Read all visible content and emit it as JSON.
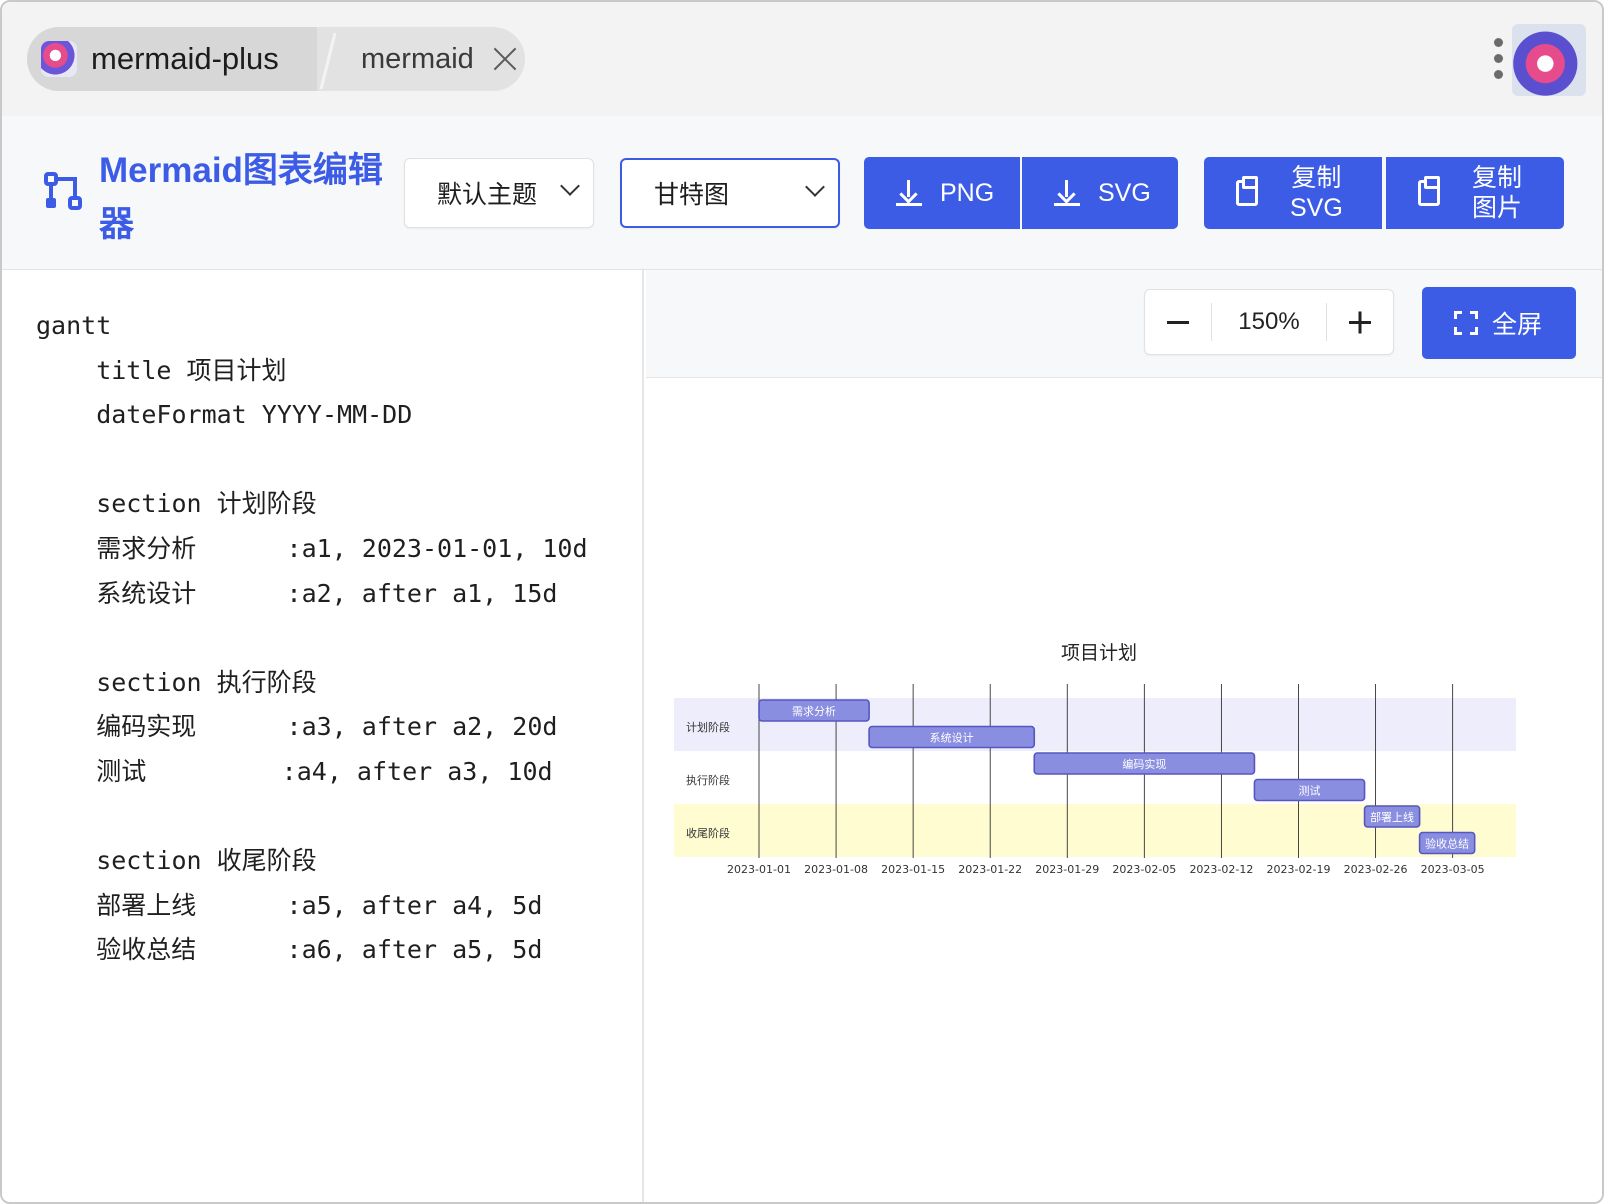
{
  "browser": {
    "active_tab_title": "mermaid-plus",
    "inactive_tab_title": "mermaid",
    "icons": {
      "active_tab": "app-logo-icon",
      "close": "close-icon",
      "menu": "more-vert-icon",
      "profile": "profile-avatar-icon"
    }
  },
  "toolbar": {
    "app_title": "Mermaid图表编辑器",
    "logo_icon": "flow-diagram-icon",
    "theme_select": {
      "value": "默认主题"
    },
    "type_select": {
      "value": "甘特图"
    },
    "buttons": {
      "png": "PNG",
      "svg": "SVG",
      "copy_svg": "复制\nSVG",
      "copy_image": "复制\n图片"
    },
    "accent_color": "#3d5ce6"
  },
  "editor": {
    "lines": [
      "gantt",
      "    title 项目计划",
      "    dateFormat YYYY-MM-DD",
      "",
      "    section 计划阶段",
      "    需求分析      :a1, 2023-01-01, 10d",
      "    系统设计      :a2, after a1, 15d",
      "",
      "    section 执行阶段",
      "    编码实现      :a3, after a2, 20d",
      "    测试         :a4, after a3, 10d",
      "",
      "    section 收尾阶段",
      "    部署上线      :a5, after a4, 5d",
      "    验收总结      :a6, after a5, 5d"
    ]
  },
  "preview": {
    "zoom": "150%",
    "fullscreen_label": "全屏",
    "icons": {
      "zoom_out": "minus-icon",
      "zoom_in": "plus-icon",
      "fullscreen": "fullscreen-icon"
    }
  },
  "chart_data": {
    "type": "gantt",
    "title": "项目计划",
    "start_date": "2023-01-01",
    "x_ticks": [
      "2023-01-01",
      "2023-01-08",
      "2023-01-15",
      "2023-01-22",
      "2023-01-29",
      "2023-02-05",
      "2023-02-12",
      "2023-02-19",
      "2023-02-26",
      "2023-03-05"
    ],
    "sections": [
      {
        "name": "计划阶段",
        "color": "#eeedfb"
      },
      {
        "name": "执行阶段",
        "color": "#ffffff"
      },
      {
        "name": "收尾阶段",
        "color": "#fefcd0"
      }
    ],
    "tasks": [
      {
        "id": "a1",
        "name": "需求分析",
        "section": "计划阶段",
        "start": "2023-01-01",
        "end": "2023-01-11"
      },
      {
        "id": "a2",
        "name": "系统设计",
        "section": "计划阶段",
        "start": "2023-01-11",
        "end": "2023-01-26"
      },
      {
        "id": "a3",
        "name": "编码实现",
        "section": "执行阶段",
        "start": "2023-01-26",
        "end": "2023-02-15"
      },
      {
        "id": "a4",
        "name": "测试",
        "section": "执行阶段",
        "start": "2023-02-15",
        "end": "2023-02-25"
      },
      {
        "id": "a5",
        "name": "部署上线",
        "section": "收尾阶段",
        "start": "2023-02-25",
        "end": "2023-03-02"
      },
      {
        "id": "a6",
        "name": "验收总结",
        "section": "收尾阶段",
        "start": "2023-03-02",
        "end": "2023-03-07"
      }
    ],
    "bar_color": "#8a8ee0",
    "bar_border": "#5656c0"
  }
}
